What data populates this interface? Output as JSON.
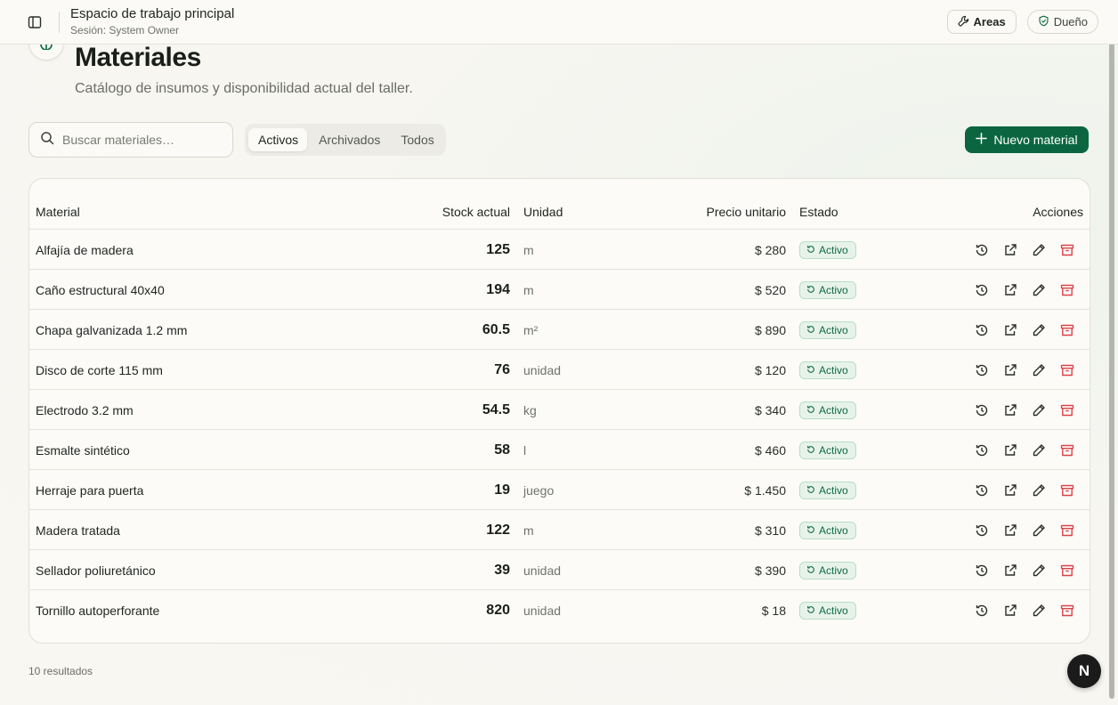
{
  "topbar": {
    "workspace_title": "Espacio de trabajo principal",
    "session": "Sesión: System Owner",
    "areas_label": "Areas",
    "owner_label": "Dueño"
  },
  "header": {
    "title": "Materiales",
    "subtitle": "Catálogo de insumos y disponibilidad actual del taller."
  },
  "toolbar": {
    "search_placeholder": "Buscar materiales…",
    "filters": [
      "Activos",
      "Archivados",
      "Todos"
    ],
    "active_filter": "Activos",
    "new_button": "Nuevo material"
  },
  "table": {
    "columns": {
      "material": "Material",
      "stock": "Stock actual",
      "unit": "Unidad",
      "price": "Precio unitario",
      "state": "Estado",
      "actions": "Acciones"
    },
    "rows": [
      {
        "name": "Alfajía de madera",
        "stock": "125",
        "unit": "m",
        "price": "$ 280",
        "state": "Activo"
      },
      {
        "name": "Caño estructural 40x40",
        "stock": "194",
        "unit": "m",
        "price": "$ 520",
        "state": "Activo"
      },
      {
        "name": "Chapa galvanizada 1.2 mm",
        "stock": "60.5",
        "unit": "m²",
        "price": "$ 890",
        "state": "Activo"
      },
      {
        "name": "Disco de corte 115 mm",
        "stock": "76",
        "unit": "unidad",
        "price": "$ 120",
        "state": "Activo"
      },
      {
        "name": "Electrodo 3.2 mm",
        "stock": "54.5",
        "unit": "kg",
        "price": "$ 340",
        "state": "Activo"
      },
      {
        "name": "Esmalte sintético",
        "stock": "58",
        "unit": "l",
        "price": "$ 460",
        "state": "Activo"
      },
      {
        "name": "Herraje para puerta",
        "stock": "19",
        "unit": "juego",
        "price": "$ 1.450",
        "state": "Activo"
      },
      {
        "name": "Madera tratada",
        "stock": "122",
        "unit": "m",
        "price": "$ 310",
        "state": "Activo"
      },
      {
        "name": "Sellador poliuretánico",
        "stock": "39",
        "unit": "unidad",
        "price": "$ 390",
        "state": "Activo"
      },
      {
        "name": "Tornillo autoperforante",
        "stock": "820",
        "unit": "unidad",
        "price": "$ 18",
        "state": "Activo"
      }
    ],
    "row_actions": [
      "history-icon",
      "open-external-icon",
      "edit-icon",
      "archive-icon"
    ]
  },
  "footer": {
    "results": "10 resultados",
    "avatar_letter": "N"
  },
  "colors": {
    "accent": "#0b6640",
    "badge_text": "#0e6a43",
    "badge_bg": "#e7f3ea",
    "danger": "#d9434a"
  }
}
